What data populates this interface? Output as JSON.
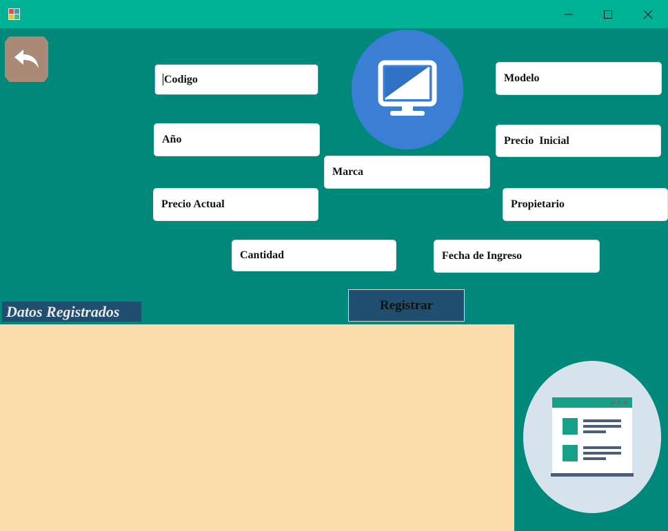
{
  "window": {
    "title": "",
    "controls": {
      "minimize": "minimize-icon",
      "maximize": "maximize-icon",
      "close": "close-icon"
    }
  },
  "form": {
    "codigo": {
      "value": "Codigo"
    },
    "modelo": {
      "value": "Modelo"
    },
    "anio": {
      "value": "Año"
    },
    "precio_inicial": {
      "value": "Precio  Inicial"
    },
    "marca": {
      "value": "Marca"
    },
    "precio_actual": {
      "value": "Precio Actual"
    },
    "propietario": {
      "value": "Propietario"
    },
    "cantidad": {
      "value": "Cantidad"
    },
    "fecha_ingreso": {
      "value": "Fecha de Ingreso"
    }
  },
  "actions": {
    "register_label": "Registrar"
  },
  "section": {
    "title": "Datos Registrados"
  },
  "colors": {
    "titlebar": "#00b294",
    "background": "#00897b",
    "button_dark": "#1f4e6e",
    "grid_background": "#fcdcab",
    "monitor_circle": "#3a7fd4",
    "report_circle": "#d7e3ec",
    "back_button": "#a88a76"
  }
}
